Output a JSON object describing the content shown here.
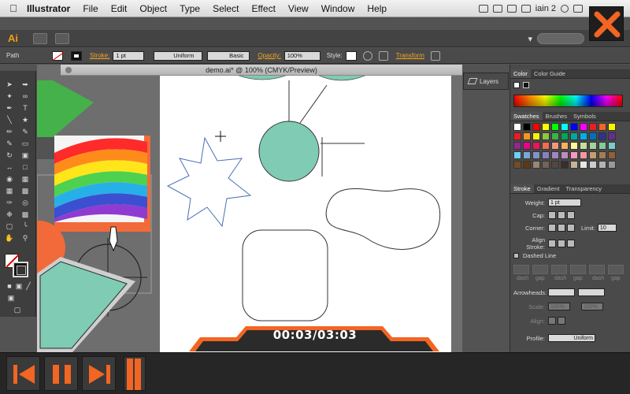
{
  "menubar": {
    "app": "Illustrator",
    "items": [
      "File",
      "Edit",
      "Object",
      "Type",
      "Select",
      "Effect",
      "View",
      "Window",
      "Help"
    ],
    "user": "iain 2"
  },
  "appbar": {
    "logo": "Ai"
  },
  "controlbar": {
    "selection": "Path",
    "stroke_label": "Stroke:",
    "stroke_weight": "1 pt",
    "profile": "Uniform",
    "brush": "Basic",
    "opacity_label": "Opacity:",
    "opacity": "100%",
    "style_label": "Style:",
    "transform_label": "Transform"
  },
  "document": {
    "tab_title": "demo.ai* @ 100% (CMYK/Preview)"
  },
  "layers": {
    "label": "Layers"
  },
  "color_panel": {
    "tabs": [
      "Color",
      "Color Guide"
    ]
  },
  "swatches_panel": {
    "tabs": [
      "Swatches",
      "Brushes",
      "Symbols"
    ],
    "colors": [
      "#ffffff",
      "#000000",
      "#ff0000",
      "#ffff00",
      "#00ff00",
      "#00ffff",
      "#0000ff",
      "#ff00ff",
      "#ee1d24",
      "#f26522",
      "#fff200",
      "#ed1c24",
      "#f7941d",
      "#fff200",
      "#8dc63f",
      "#39b54a",
      "#00a651",
      "#00a99d",
      "#00aeef",
      "#0072bc",
      "#2e3192",
      "#662d91",
      "#92278f",
      "#ec008c",
      "#ed145b",
      "#f26c4f",
      "#f69679",
      "#fbaf5d",
      "#fff799",
      "#c4df9b",
      "#a3d39c",
      "#82ca9c",
      "#7accc8",
      "#6dcff6",
      "#7da7d9",
      "#8393ca",
      "#8781bd",
      "#a186be",
      "#bd8cbf",
      "#f49ac1",
      "#f5989d",
      "#c69c6d",
      "#a67c52",
      "#8c6239",
      "#754c24",
      "#603913",
      "#998675",
      "#736357",
      "#534741",
      "#362f2d",
      "#c7b299",
      "#e6e6e6",
      "#cccccc",
      "#b3b3b3",
      "#999999"
    ]
  },
  "stroke_panel": {
    "tabs": [
      "Stroke",
      "Gradient",
      "Transparency"
    ],
    "weight_label": "Weight:",
    "weight": "1 pt",
    "cap_label": "Cap:",
    "corner_label": "Corner:",
    "limit_label": "Limit:",
    "limit": "10",
    "align_label": "Align Stroke:",
    "dashed_label": "Dashed Line",
    "dash_labels": [
      "dash",
      "gap",
      "dash",
      "gap",
      "dash",
      "gap"
    ],
    "arrowheads_label": "Arrowheads:",
    "scale_label": "Scale:",
    "scale_start": "100%",
    "scale_end": "100%",
    "align2_label": "Align:",
    "profile_label": "Profile:",
    "profile": "Uniform"
  },
  "player": {
    "timecode": "00:03/03:03"
  },
  "colors": {
    "accent": "#f26522",
    "shape_fill": "#7fcbb4"
  }
}
